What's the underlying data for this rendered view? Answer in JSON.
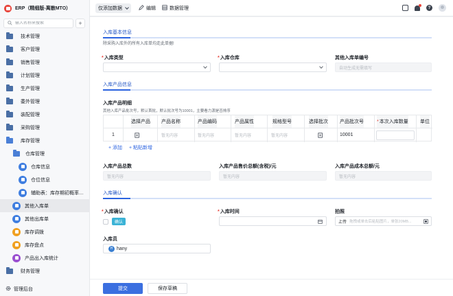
{
  "app": {
    "title": "ERP（精细版-离散MTO）"
  },
  "sidebar": {
    "search_placeholder": "输入名称来搜索",
    "add_label": "+",
    "items": [
      {
        "label": "技术管理"
      },
      {
        "label": "客户管理"
      },
      {
        "label": "销售管理"
      },
      {
        "label": "计划管理"
      },
      {
        "label": "生产管理"
      },
      {
        "label": "委外管理"
      },
      {
        "label": "装配管理"
      },
      {
        "label": "采购管理"
      },
      {
        "label": "库存管理"
      },
      {
        "label": "仓库管理"
      },
      {
        "label": "仓库信息"
      },
      {
        "label": "仓位信息"
      },
      {
        "label": "辅助表：库存期初概率…"
      },
      {
        "label": "其他入库单"
      },
      {
        "label": "其他出库单"
      },
      {
        "label": "库存调拨"
      },
      {
        "label": "库存盘点"
      },
      {
        "label": "产品出入库统计"
      },
      {
        "label": "财务管理"
      }
    ],
    "footer": "管理后台"
  },
  "topbar": {
    "view_select": "仅添加数据",
    "edit": "编辑",
    "data_manage": "数据管理"
  },
  "form": {
    "basic": {
      "title": "入库基本信息",
      "hint": "除采购入库外的所有入库单均走此单据!",
      "type_label": "入库类型",
      "warehouse_label": "入库仓库",
      "number_label": "其他入库单编号",
      "number_placeholder": "自动生成无需填写"
    },
    "products": {
      "title": "入库产品信息",
      "detail_label": "入库产品明细",
      "detail_hint": "其他入库产品批次号，默认首批，默认批次号为10001，主要看力源是否排序",
      "columns": [
        "选择产品",
        "产品名称",
        "产品编码",
        "产品属性",
        "规格型号",
        "选择批次",
        "产品批次号",
        "本次入库数量",
        "单位"
      ],
      "row": {
        "index": "1",
        "placeholder": "暂无内容",
        "batch_no": "10001"
      },
      "add": "+ 添加",
      "paste": "+ 粘贴新增",
      "total_label": "入库产品总数",
      "total_value": "暂无内容",
      "sale_label": "入库产品售价总额(含税)/元",
      "sale_value": "暂无内容",
      "cost_label": "入库产品成本总额/元",
      "cost_value": "暂无内容"
    },
    "confirm": {
      "title": "入库确认",
      "confirm_label": "入库确认",
      "confirm_tag": "确认",
      "time_label": "入库时间",
      "photo_label": "拍照",
      "photo_btn": "上传",
      "photo_hint": "拖拽或单击后粘贴图片，单张20MB...",
      "operator_label": "入库员",
      "operator_avatar": "H",
      "operator_name": "hany"
    },
    "submit": "提交",
    "save_draft": "保存草稿"
  }
}
